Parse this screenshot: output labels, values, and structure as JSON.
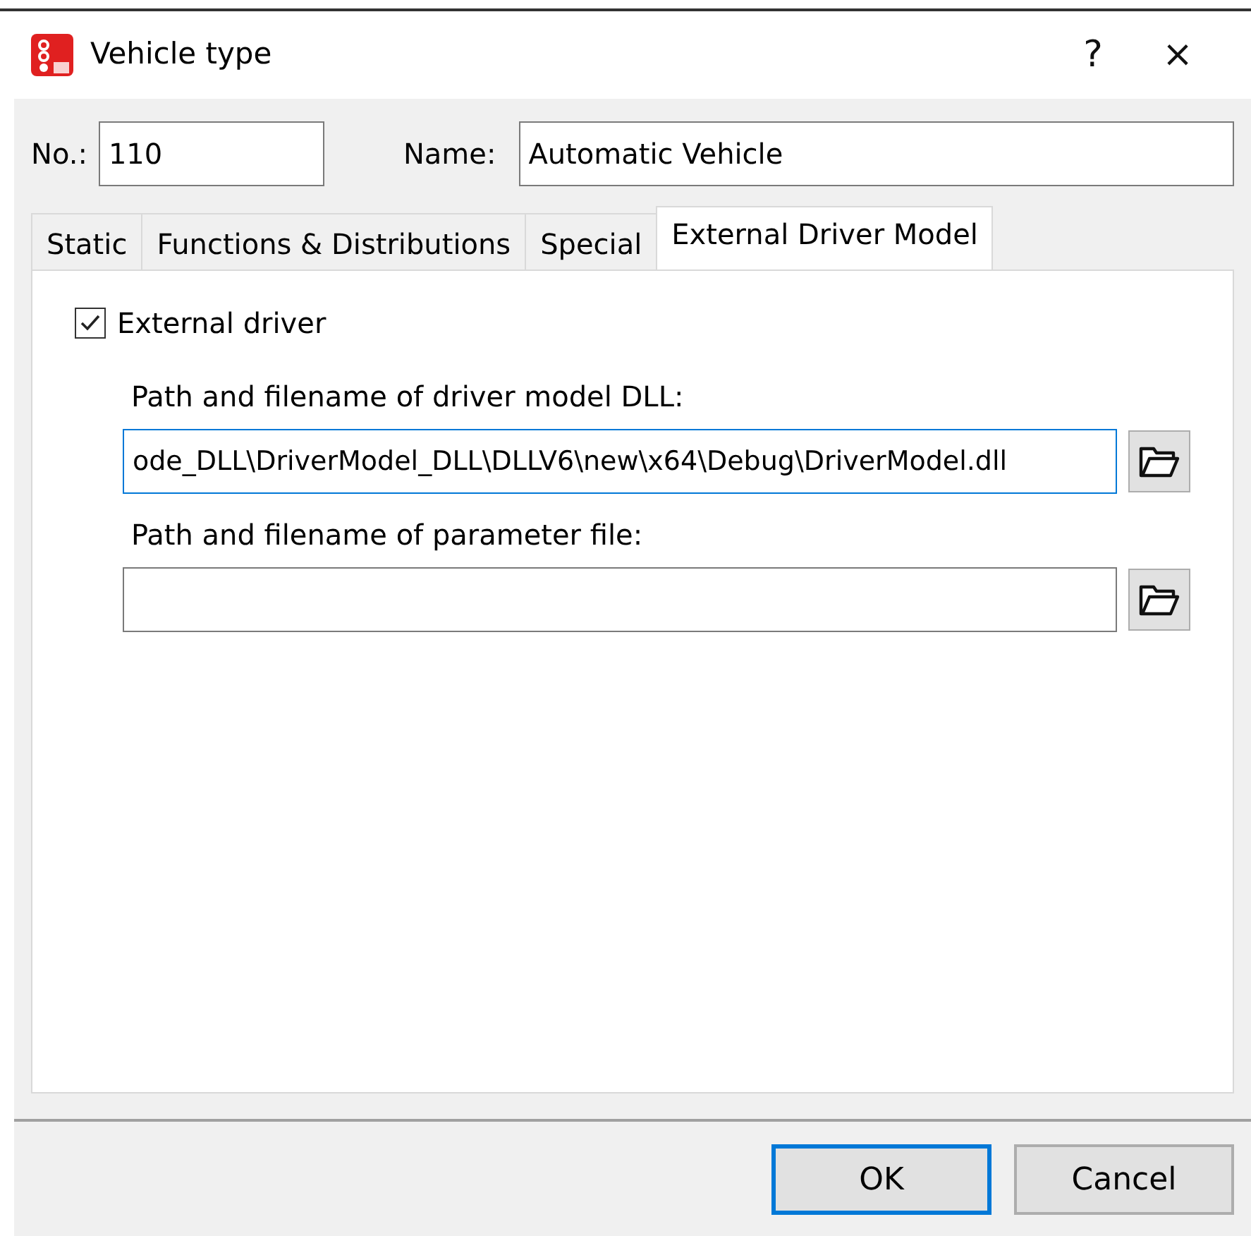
{
  "window": {
    "title": "Vehicle type",
    "help": "?",
    "close": "×"
  },
  "no": {
    "label": "No.:",
    "value": "110"
  },
  "name": {
    "label": "Name:",
    "value": "Automatic Vehicle"
  },
  "tabs": [
    {
      "label": "Static",
      "selected": false
    },
    {
      "label": "Functions & Distributions",
      "selected": false
    },
    {
      "label": "Special",
      "selected": false
    },
    {
      "label": "External Driver Model",
      "selected": true
    }
  ],
  "external_driver": {
    "label": "External driver",
    "checked": true
  },
  "fields": [
    {
      "label": "Path and filename of driver model DLL:",
      "value": "ode_DLL\\DriverModel_DLL\\DLLV6\\new\\x64\\Debug\\DriverModel.dll",
      "focused": true
    },
    {
      "label": "Path and filename of parameter file:",
      "focused": false
    }
  ],
  "buttons": [
    {
      "label": "OK",
      "default": true
    },
    {
      "label": "Cancel",
      "default": false
    }
  ]
}
